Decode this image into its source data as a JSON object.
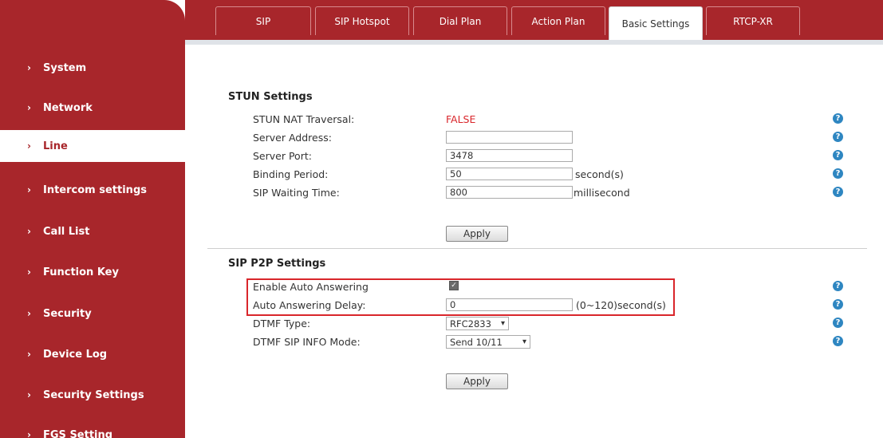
{
  "sidebar": {
    "items": [
      {
        "label": "System"
      },
      {
        "label": "Network"
      },
      {
        "label": "Line"
      },
      {
        "label": "Intercom settings"
      },
      {
        "label": "Call List"
      },
      {
        "label": "Function Key"
      },
      {
        "label": "Security"
      },
      {
        "label": "Device Log"
      },
      {
        "label": "Security Settings"
      },
      {
        "label": "FGS Setting"
      }
    ],
    "active_item": "Line",
    "chevron": "›"
  },
  "tabs": [
    {
      "label": "SIP"
    },
    {
      "label": "SIP Hotspot"
    },
    {
      "label": "Dial Plan"
    },
    {
      "label": "Action Plan"
    },
    {
      "label": "Basic Settings"
    },
    {
      "label": "RTCP-XR"
    }
  ],
  "active_tab": "Basic Settings",
  "stun": {
    "title": "STUN Settings",
    "nat_traversal_label": "STUN NAT Traversal:",
    "nat_traversal_value": "FALSE",
    "server_address_label": "Server Address:",
    "server_address_value": "",
    "server_port_label": "Server Port:",
    "server_port_value": "3478",
    "binding_period_label": "Binding Period:",
    "binding_period_value": "50",
    "binding_period_unit": "second(s)",
    "sip_waiting_label": "SIP Waiting Time:",
    "sip_waiting_value": "800",
    "sip_waiting_unit": "millisecond",
    "apply_label": "Apply"
  },
  "p2p": {
    "title": "SIP P2P Settings",
    "auto_answer_label": "Enable Auto Answering",
    "auto_answer_checked": true,
    "auto_answer_delay_label": "Auto Answering Delay:",
    "auto_answer_delay_value": "0",
    "auto_answer_delay_unit": "(0~120)second(s)",
    "dtmf_type_label": "DTMF Type:",
    "dtmf_type_value": "RFC2833",
    "dtmf_sip_info_label": "DTMF SIP INFO Mode:",
    "dtmf_sip_info_value": "Send 10/11",
    "apply_label": "Apply"
  },
  "help_glyph": "?",
  "colors": {
    "brand_red": "#a8262b",
    "false_red": "#d9262b",
    "help_blue": "#2e86c1"
  },
  "icons": {
    "help": "help-icon",
    "chevron": "chevron-right-icon",
    "dropdown": "chevron-down-icon",
    "check": "checkmark-icon"
  }
}
